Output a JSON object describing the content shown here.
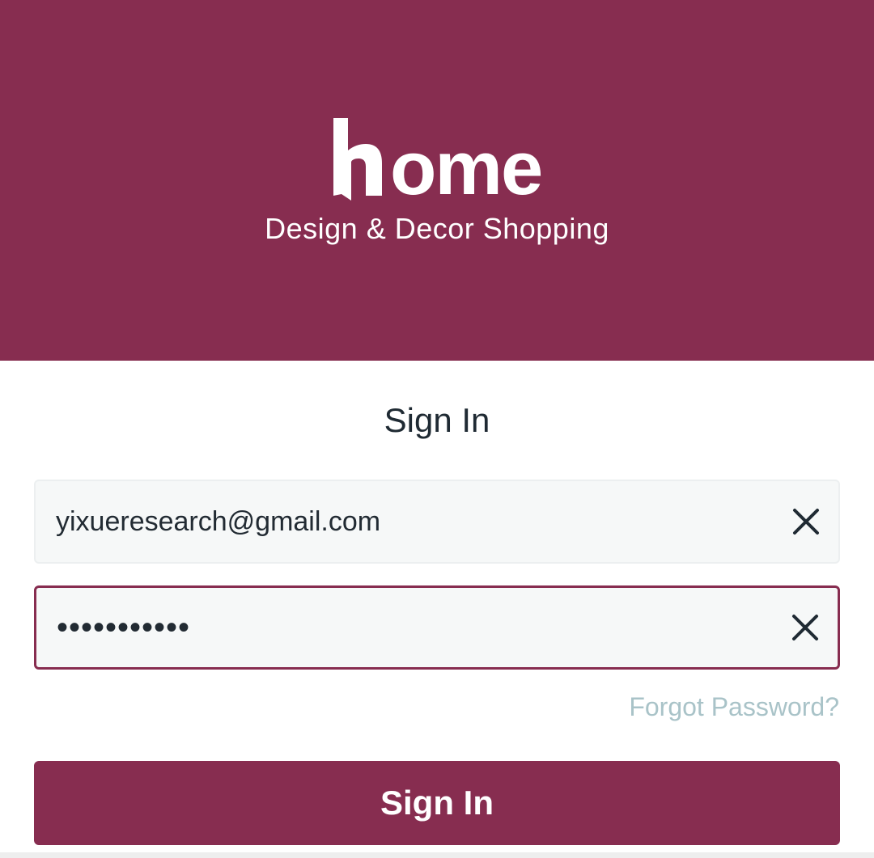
{
  "brand": {
    "logo_text": "home",
    "tagline": "Design & Decor Shopping",
    "color": "#872d50"
  },
  "form": {
    "title": "Sign In",
    "email": {
      "value": "yixueresearch@gmail.com",
      "clear_icon": "close-icon"
    },
    "password": {
      "masked_value": "•••••••••••",
      "clear_icon": "close-icon"
    },
    "forgot_password": "Forgot Password?",
    "submit_label": "Sign In"
  },
  "colors": {
    "accent": "#872d50",
    "link": "#a9c3c8",
    "text": "#1f2a33",
    "field_bg": "#f6f8f8"
  }
}
